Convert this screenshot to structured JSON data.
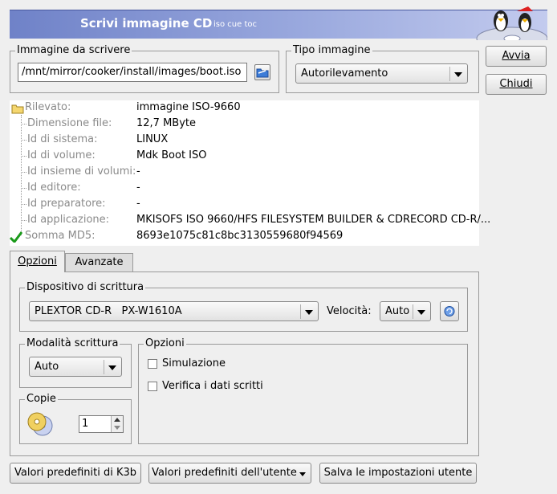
{
  "header": {
    "title": "Scrivi immagine CD",
    "subtitle": "iso cue toc"
  },
  "buttons": {
    "start": "Avvia",
    "close": "Chiudi",
    "k3b_defaults": "Valori predefiniti di K3b",
    "user_defaults": "Valori predefiniti dell'utente",
    "save_user": "Salva le impostazioni utente"
  },
  "image": {
    "group_title": "Immagine da scrivere",
    "path": "/mnt/mirror/cooker/install/images/boot.iso"
  },
  "image_type": {
    "group_title": "Tipo immagine",
    "selected": "Autorilevamento"
  },
  "info": {
    "rows": [
      {
        "label": "Rilevato:",
        "value": "immagine ISO-9660"
      },
      {
        "label": "Dimensione file:",
        "value": "12,7 MByte"
      },
      {
        "label": "Id di sistema:",
        "value": "LINUX"
      },
      {
        "label": "Id di volume:",
        "value": "Mdk Boot ISO"
      },
      {
        "label": "Id insieme di volumi:",
        "value": "-"
      },
      {
        "label": "Id editore:",
        "value": "-"
      },
      {
        "label": "Id preparatore:",
        "value": "-"
      },
      {
        "label": "Id applicazione:",
        "value": "MKISOFS ISO 9660/HFS FILESYSTEM BUILDER & CDRECORD CD-R/..."
      },
      {
        "label": "Somma MD5:",
        "value": "8693e1075c81c8bc3130559680f94569"
      }
    ]
  },
  "tabs": {
    "options": "Opzioni",
    "advanced": "Avanzate"
  },
  "device": {
    "group_title": "Dispositivo di scrittura",
    "selected": "PLEXTOR CD-R   PX-W1610A",
    "speed_label": "Velocità:",
    "speed": "Auto"
  },
  "mode": {
    "group_title": "Modalità scrittura",
    "selected": "Auto"
  },
  "options": {
    "group_title": "Opzioni",
    "simulation": "Simulazione",
    "verify": "Verifica i dati scritti"
  },
  "copies": {
    "group_title": "Copie",
    "value": "1"
  }
}
